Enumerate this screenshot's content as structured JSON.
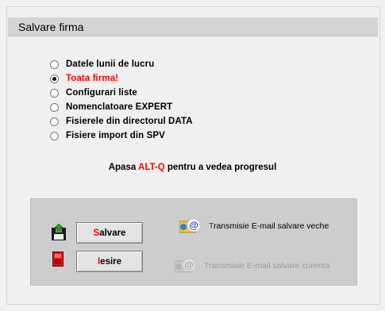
{
  "window": {
    "title": "Salvare firma"
  },
  "options": [
    {
      "label": "Datele lunii de lucru",
      "selected": false
    },
    {
      "label": "Toata firma!",
      "selected": true
    },
    {
      "label": "Configurari liste",
      "selected": false
    },
    {
      "label": "Nomenclatoare EXPERT",
      "selected": false
    },
    {
      "label": "Fisierele din directorul DATA",
      "selected": false
    },
    {
      "label": "Fisiere import din SPV",
      "selected": false
    }
  ],
  "hint": {
    "prefix": "Apasa ",
    "key": "ALT-Q",
    "suffix": " pentru a vedea progresul"
  },
  "buttons": {
    "save": {
      "hotkey": "S",
      "rest": "alvare"
    },
    "exit": {
      "hotkey": "I",
      "rest": "esire"
    }
  },
  "email": {
    "old": {
      "hotkey": "T",
      "rest": "ransmisie E-mail salvare veche",
      "enabled": true
    },
    "current": {
      "label": "Transmisie E-mail salvare curenta",
      "enabled": false
    }
  },
  "colors": {
    "accent_red": "#ff0000",
    "panel": "#cdcdcd",
    "title_bar": "#d4d4d4",
    "disabled_text": "#9a9a9a"
  },
  "icons": {
    "save": "floppy-save-icon",
    "exit": "exit-door-icon",
    "email": "email-at-icon"
  }
}
